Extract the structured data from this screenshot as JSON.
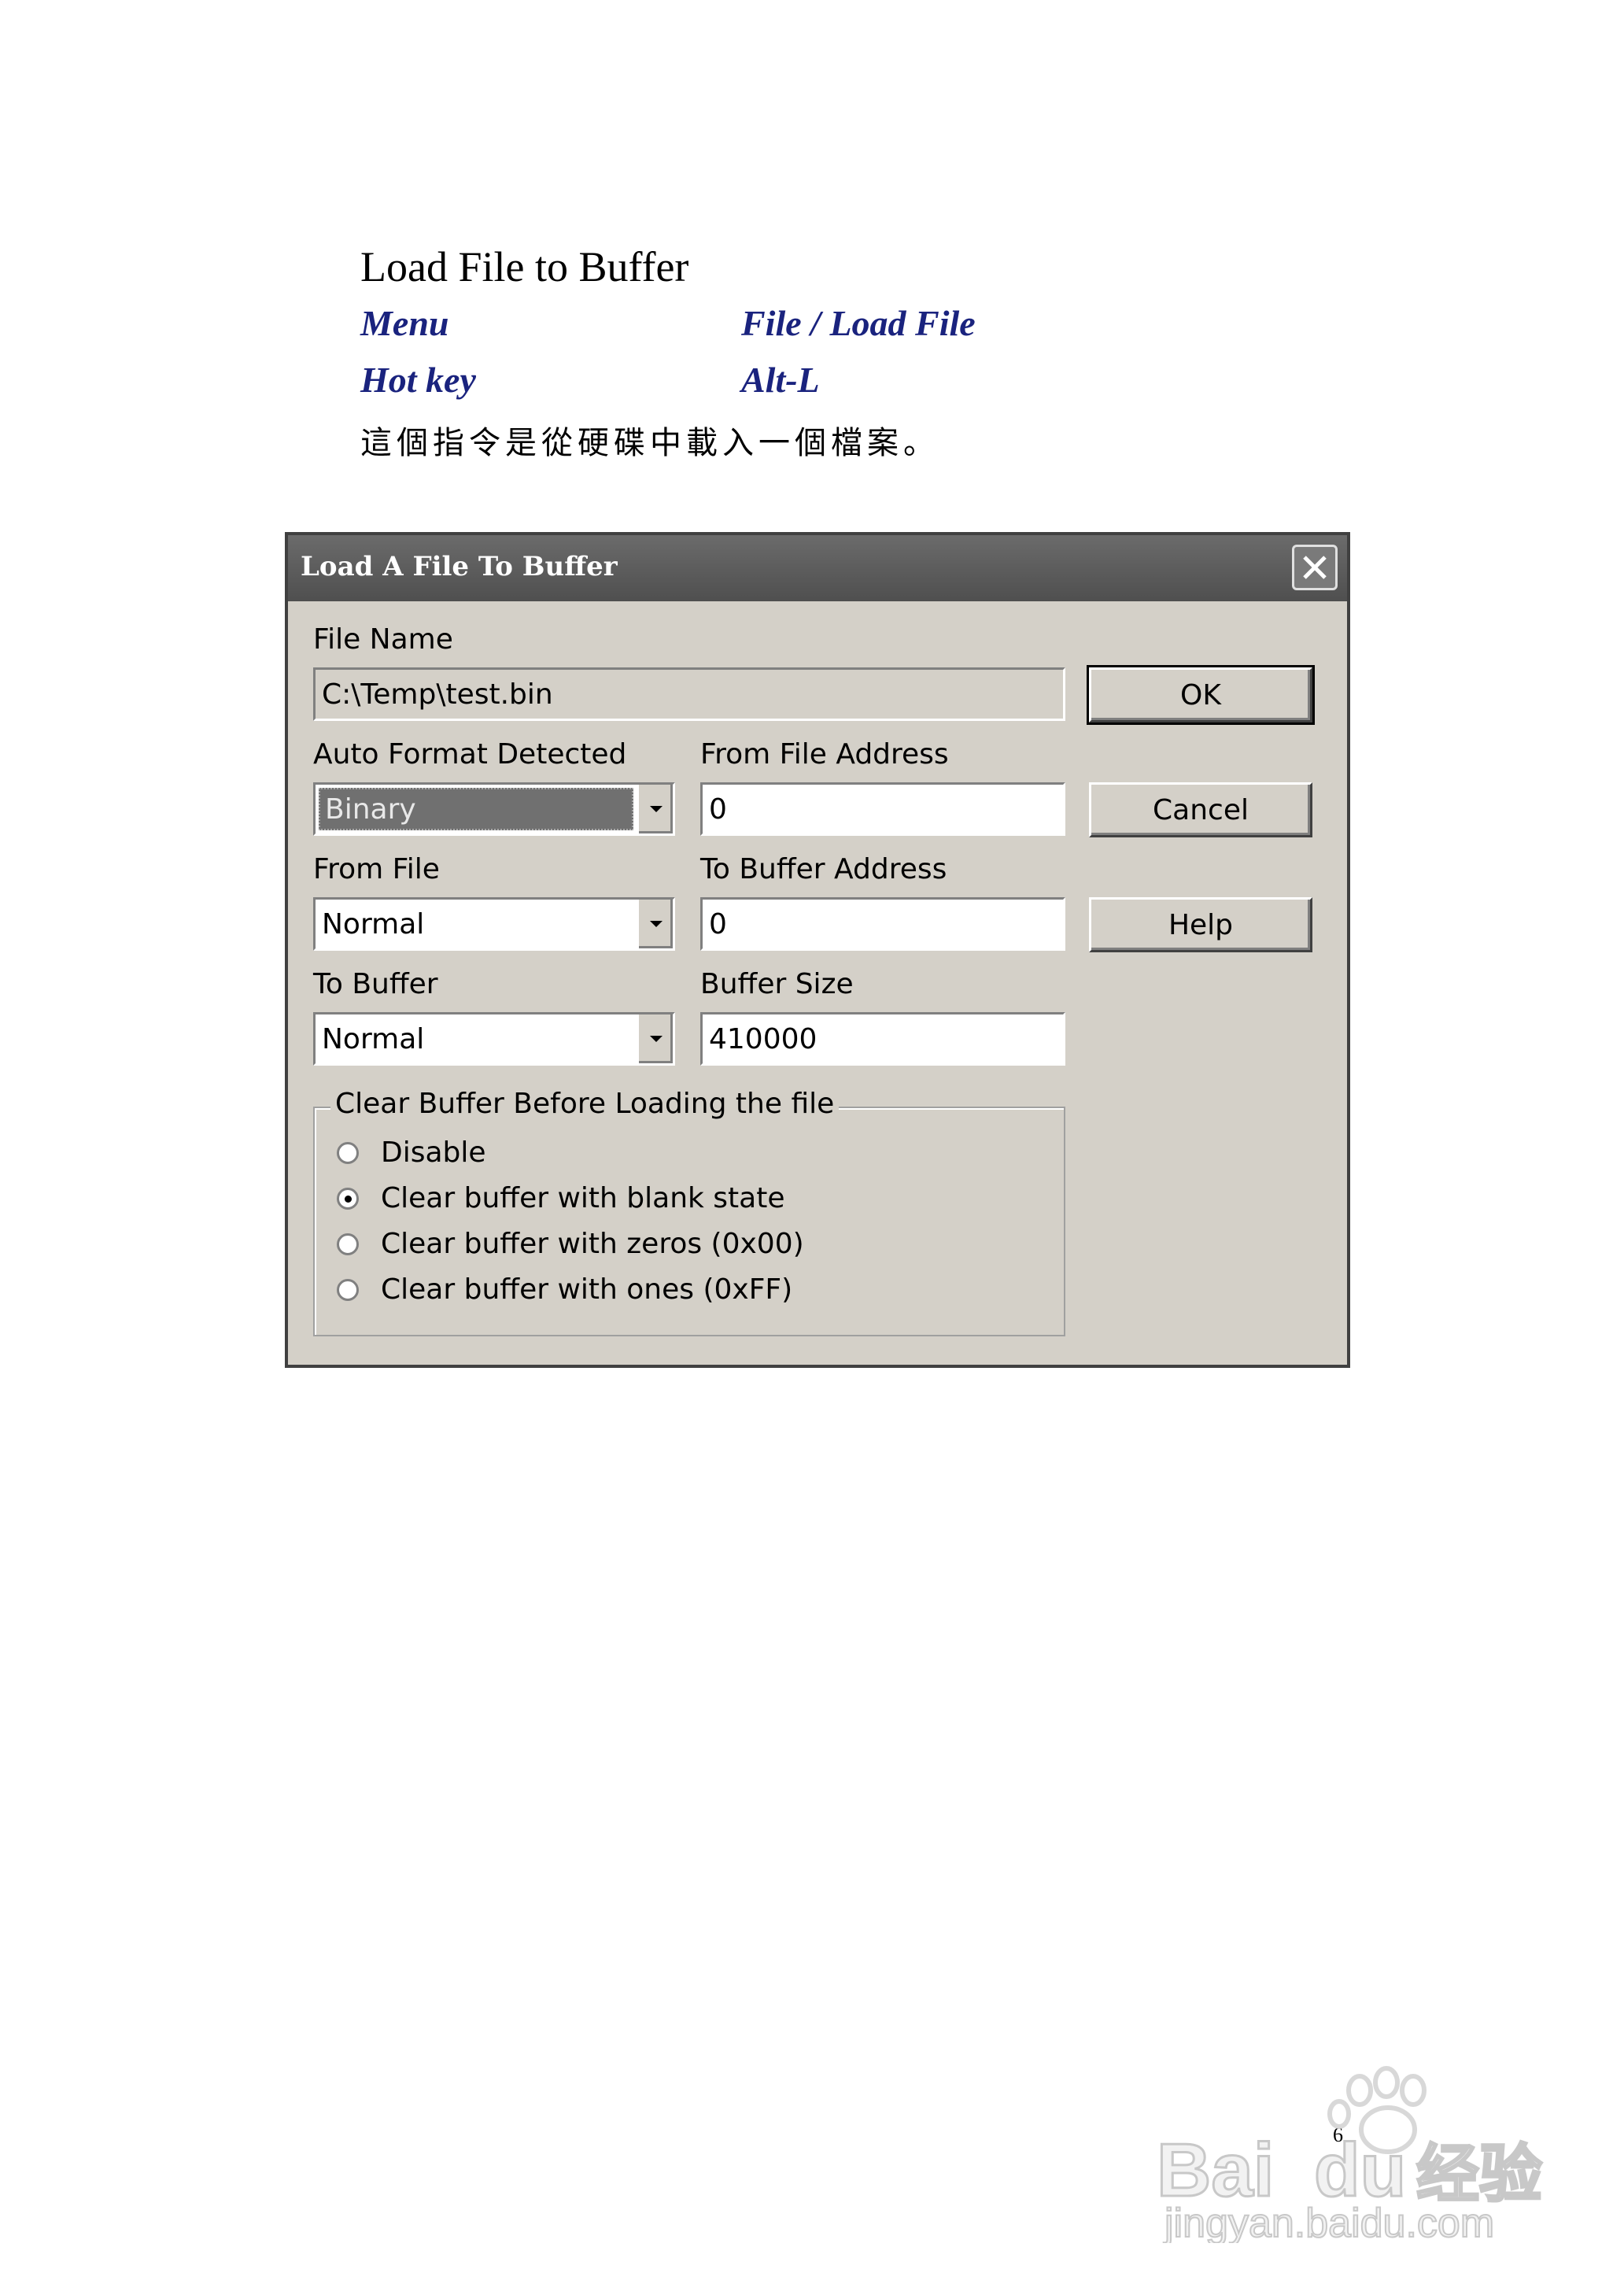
{
  "doc": {
    "heading": "Load File to Buffer",
    "menu_label": "Menu",
    "menu_value": "File / Load File",
    "hotkey_label": "Hot key",
    "hotkey_value": "Alt-L",
    "description": "這個指令是從硬碟中載入一個檔案。",
    "page_number": "6"
  },
  "dialog": {
    "title": "Load A File To Buffer",
    "file_name_label": "File Name",
    "file_name_value": "C:\\Temp\\test.bin",
    "auto_format_label": "Auto Format Detected",
    "auto_format_value": "Binary",
    "from_file_address_label": "From File Address",
    "from_file_address_value": "0",
    "from_file_label": "From File",
    "from_file_value": "Normal",
    "to_buffer_address_label": "To Buffer Address",
    "to_buffer_address_value": "0",
    "to_buffer_label": "To Buffer",
    "to_buffer_value": "Normal",
    "buffer_size_label": "Buffer Size",
    "buffer_size_value": "410000",
    "ok_label": "OK",
    "cancel_label": "Cancel",
    "help_label": "Help",
    "clear_group_title": "Clear Buffer Before Loading the file",
    "options": [
      {
        "label": "Disable",
        "selected": false
      },
      {
        "label": "Clear buffer with blank state",
        "selected": true
      },
      {
        "label": "Clear buffer with zeros (0x00)",
        "selected": false
      },
      {
        "label": "Clear buffer with ones (0xFF)",
        "selected": false
      }
    ]
  },
  "watermark": {
    "brand": "Bai",
    "brand2": "du",
    "cn": "经验",
    "url": "jingyan.baidu.com"
  },
  "colors": {
    "accent_text": "#1a237e",
    "dialog_face": "#d4d0c8",
    "titlebar": "#5a5a5a"
  }
}
